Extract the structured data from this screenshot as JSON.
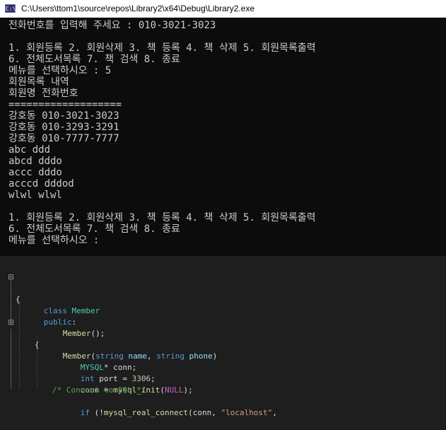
{
  "console": {
    "title": "C:\\Users\\ttom1\\source\\repos\\Library2\\x64\\Debug\\Library2.exe",
    "icon_text": "C:\\",
    "lines": [
      "전화번호를 입력해 주세요 : 010-3021-3023",
      "",
      "1. 회원등록 2. 회원삭제 3. 책 등록 4. 책 삭제 5. 회원목록출력",
      "6. 전체도서목록 7. 책 검색 8. 종료",
      "메뉴를 선택하시오 : 5",
      "회원목록 내역",
      "회원명 전화번호",
      "===================",
      "강호동 010-3021-3023",
      "강호동 010-3293-3291",
      "강호동 010-7777-7777",
      "abc ddd",
      "abcd dddo",
      "accc dddo",
      "acccd dddod",
      "wlwl wlwl",
      "",
      "1. 회원등록 2. 회원삭제 3. 책 등록 4. 책 삭제 5. 회원목록출력",
      "6. 전체도서목록 7. 책 검색 8. 종료",
      "메뉴를 선택하시오 :"
    ]
  },
  "editor": {
    "line1": {
      "kw": "class",
      "name": "Member"
    },
    "line2": "{",
    "line3": {
      "kw": "public",
      "colon": ":"
    },
    "line4": {
      "fn": "Member",
      "rest": "();"
    },
    "line5": {
      "fn": "Member",
      "open": "(",
      "type1": "string",
      "p1": "name",
      "comma": ", ",
      "type2": "string",
      "p2": "phone",
      "close": ")"
    },
    "line6": "{",
    "line7": {
      "type": "MYSQL",
      "rest": "* conn;"
    },
    "line8": {
      "kw": "int",
      "mid": " port = ",
      "num": "3306",
      "end": ";"
    },
    "line9": {
      "lhs": "conn = ",
      "fn": "mysql_init",
      "open": "(",
      "macro": "NULL",
      "close": ");"
    },
    "line10": "/* Connect to SQL */",
    "line11": {
      "kw": "if",
      "mid": " (!",
      "fn": "mysql_real_connect",
      "open": "(conn, ",
      "str": "\"localhost\"",
      "end": ","
    }
  }
}
